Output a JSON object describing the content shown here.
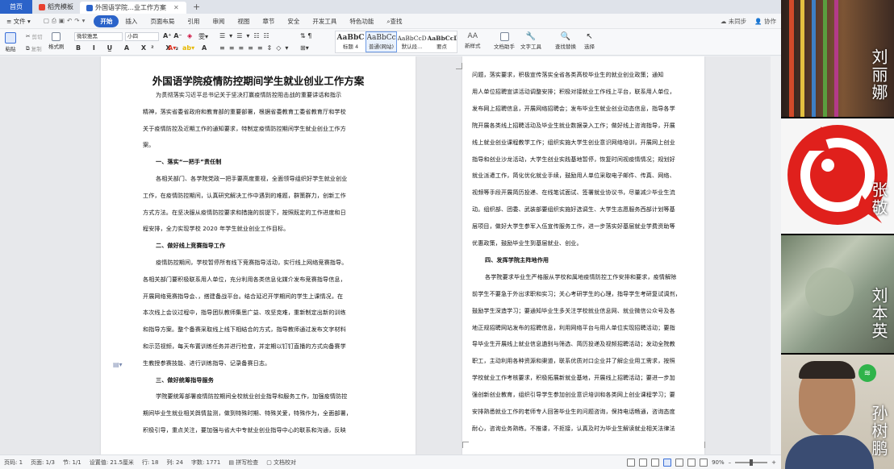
{
  "tabs": {
    "home": "首页",
    "t1": "稻壳模板",
    "t2": "外国语学院…业工作方案"
  },
  "menu": {
    "file": "文件",
    "start": "开始",
    "insert": "插入",
    "layout": "页面布局",
    "ref": "引用",
    "review": "审阅",
    "view": "视图",
    "chapter": "章节",
    "security": "安全",
    "dev": "开发工具",
    "special": "特色功能",
    "search": "查找",
    "sync": "未同步",
    "collab": "协作"
  },
  "ribbon": {
    "paste": "粘贴",
    "cut": "剪切",
    "copy": "复制",
    "painter": "格式刷",
    "font": "微软雅黑",
    "size": "小四",
    "styles": [
      {
        "preview": "AaBbC",
        "name": "标题 4"
      },
      {
        "preview": "AaBbCcD",
        "name": "普通(网站)"
      },
      {
        "preview": "AaBbCcDd",
        "name": "默认段..."
      },
      {
        "preview": "AaBbCcDd",
        "name": "要点"
      }
    ],
    "newstyle": "新样式",
    "assistant": "文档助手",
    "tools": "文字工具",
    "findreplace": "查找替换",
    "select": "选择"
  },
  "doc": {
    "title": "外国语学院疫情防控期间学生就业创业工作方案",
    "left": [
      "为贯彻落实习近平总书记关于坚决打赢疫情防控阻击战的重要讲话和指示",
      "精神，落实省委省政府和教育部的重要部署，根据省委教育工委省教育厅和学校",
      "关于疫情防控及近期工作的通知要求，特制定疫情防控期间学生就业创业工作方",
      "案。",
      "一、落实“一把手”责任制",
      "各相关部门、各学院党政一把手要高度重视，全面领导组织好学生就业创业",
      "工作，在疫情防控期间，认真研究解决工作中遇到的难题，群策群力，创新工作",
      "方式方法。在坚决服从疫情防控要求和措施的前提下，按照既定的工作进度和日",
      "程安排，全力实现学校 2020 年学生就业创业工作目标。",
      "二、做好线上竞赛指导工作",
      "疫情防控期间，学校暂停所有线下竞赛指导活动，实行线上网络竞赛指导。",
      "各相关部门要积极联系用人单位，充分利用各类信息化媒介发布竞赛指导信息，",
      "开展网络竞赛指导会、，搭建备战平台。结合延迟开学期间的学生上课情况，在",
      "本次线上会议过程中，指导团队教师集思广益、攻坚克难，重新制定出新的训练",
      "和指导方案。整个备赛采取线上线下相结合的方式，指导教师通过发布文字材料",
      "和示范视频，每天布置训练任务并进行检查，并定期以钉钉直播的方式向备赛学",
      "生教授参赛技能、进行训练指导、记录备赛日志。",
      "三、做好统筹指导服务",
      "学院要统筹部署疫情防控期间全校就业创业指导和服务工作，加强疫情防控",
      "期间毕业生就业相关舆情监测，做到特殊时期、特殊关爱，特殊作为，全面部署，",
      "积极引导，重点关注，要加强与省大中专就业创业指导中心的联系和沟通，反映"
    ],
    "right": [
      "问题，落实要求，积极宣传落实全省各类高校毕业生的就业创业政策；通知",
      "用人单位招聘宣讲活动调整安排；积极对接就业工作线上平台，联系用人单位，",
      "发布网上招聘信息，开展网络招聘会；发布毕业生就业创业动态信息，指导各学",
      "院开展各类线上招聘活动及毕业生就业数据录入工作；做好线上咨询指导，开展",
      "线上就业创业课程教学工作；组织实施大学生创业意识网络培训，开展网上创业",
      "指导和创业沙龙活动，大学生创业实践基地暂停，恢复时间视疫情情况；规划好",
      "就业派遣工作，简化优化就业手续，鼓励用人单位采取电子邮件、传真、网络、",
      "视频等手段开展简历投递、在线笔试面试、签署就业协议书，尽量减少毕业生流",
      "动。组织部、团委、武装部要组织实施好选调生、大学生志愿服务西部计划等基",
      "层项目，做好大学生参军入伍宣传服务工作，进一步落实好基层就业学费资助等",
      "优惠政策，鼓励毕业生到基层就业、创业。",
      "四、发挥学院主阵地作用",
      "各学院要求毕业生严格服从学校和属地疫情防控工作安排和要求，疫情解除",
      "前学生不要急于外出求职和实习；关心考研学生的心理，指导学生考研复试调剂，",
      "鼓励学生深造学习；要通知毕业生多关注学校就业信息网、就业微信公众号及各",
      "地正规招聘网站发布的招聘信息，利用网络平台与用人单位实现招聘活动；要指",
      "导毕业生开展线上就业信息遴别与筛选、简历投递及视频招聘活动；发动全院教",
      "职工，主动利用各种资源和渠道，联系优质对口企业并了解企业用工需求，按照",
      "学校就业工作考核要求，积极拓展新就业基地，开展线上招聘活动；要进一步加",
      "强创新创业教育，组织引导学生参加创业意识培训和各类网上创业课程学习；要",
      "安排熟悉就业工作的老师专人回答毕业生的问题咨询，保持电话畅通，咨询态度",
      "耐心，咨询业务熟练。不推诿，不拒接，认真及时为毕业生解读就业相关法律法"
    ]
  },
  "status": {
    "page": "页码: 1",
    "pages": "页面: 1/3",
    "section": "节: 1/1",
    "setting": "设置值: 21.5厘米",
    "row": "行: 18",
    "col": "列: 24",
    "words": "字数: 1771",
    "spell": "拼写检查",
    "proof": "文档校对",
    "zoom": "90%"
  },
  "video": [
    {
      "name": "刘丽娜"
    },
    {
      "name": "张敬"
    },
    {
      "name": "刘本英"
    },
    {
      "name": "孙树鹏"
    }
  ]
}
